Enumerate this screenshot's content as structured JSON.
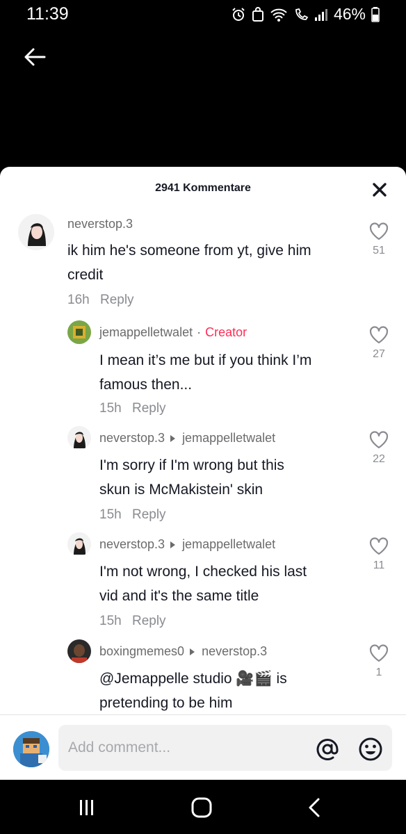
{
  "status_bar": {
    "time": "11:39",
    "battery": "46%",
    "icons": [
      "alarm-icon",
      "app-notification-icon",
      "wifi-icon",
      "wifi-calling-icon",
      "signal-icon",
      "battery-icon"
    ]
  },
  "header": {
    "back_icon": "arrow-left-icon",
    "comment_count": "2941 Kommentare",
    "close_icon": "close-icon"
  },
  "comments": [
    {
      "username": "neverstop.3",
      "text_line1": "ik him he's someone from yt, give him",
      "text_line2": "credit",
      "time": "16h",
      "reply_label": "Reply",
      "likes": "51"
    },
    {
      "username": "jemappelletwalet",
      "badge": "Creator",
      "text_line1": "I mean it’s me but if you think I’m",
      "text_line2": "famous then...",
      "time": "15h",
      "reply_label": "Reply",
      "likes": "27"
    },
    {
      "username": "neverstop.3",
      "reply_to": "jemappelletwalet",
      "text_line1": "I'm sorry if I'm wrong but this",
      "text_line2": "skun is McMakistein' skin",
      "time": "15h",
      "reply_label": "Reply",
      "likes": "22"
    },
    {
      "username": "neverstop.3",
      "reply_to": "jemappelletwalet",
      "text_line1": "I'm not wrong, I checked his last",
      "text_line2": "vid and it's the same title",
      "time": "15h",
      "reply_label": "Reply",
      "likes": "11"
    },
    {
      "username": "boxingmemes0",
      "reply_to": "neverstop.3",
      "text_line1": "@Jemappelle studio 🎥🎬 is",
      "text_line2": "pretending to be him",
      "likes": "1"
    }
  ],
  "composer": {
    "placeholder": "Add comment...",
    "mention_icon": "at-icon",
    "emoji_icon": "emoji-icon"
  },
  "colors": {
    "accent": "#fe2c55",
    "text_primary": "#161823",
    "text_secondary": "#8a8b91",
    "background": "#000000"
  }
}
